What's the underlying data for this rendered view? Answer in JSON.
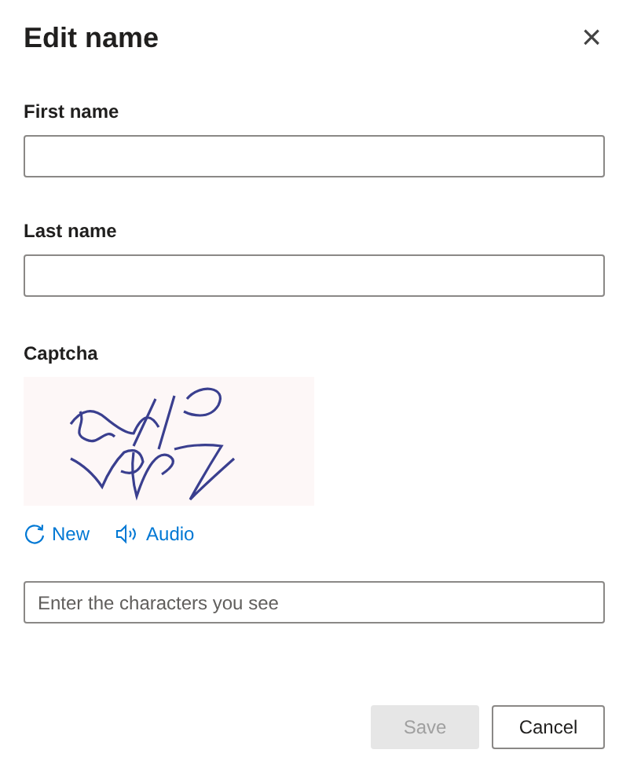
{
  "dialog": {
    "title": "Edit name",
    "close": "×"
  },
  "fields": [
    {
      "label": "First name"
    },
    {
      "label": "Last name"
    }
  ],
  "captcha": {
    "label": "Captcha",
    "actions": [
      {
        "kind": "refresh",
        "label": "New"
      },
      {
        "kind": "audio",
        "label": "Audio"
      }
    ],
    "placeholder": "Enter the characters you see"
  },
  "buttons": [
    {
      "label": "Save",
      "disabled": true
    },
    {
      "label": "Cancel",
      "disabled": false
    }
  ]
}
